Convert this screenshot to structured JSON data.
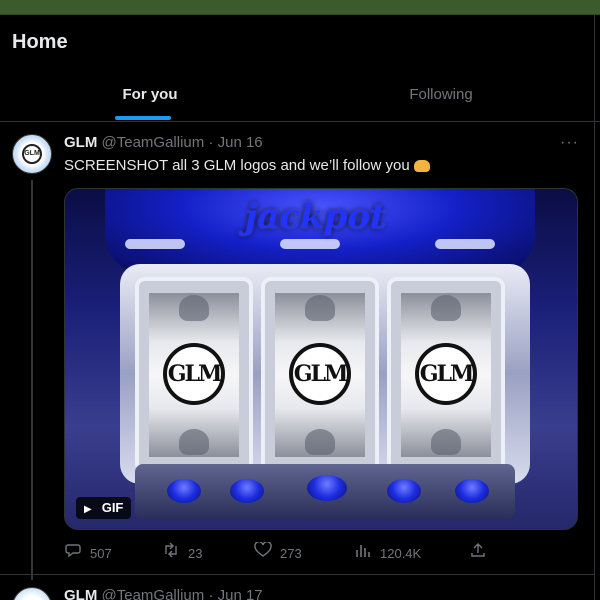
{
  "header": {
    "title": "Home",
    "tabs": [
      {
        "label": "For you",
        "active": true
      },
      {
        "label": "Following",
        "active": false
      }
    ]
  },
  "colors": {
    "accent": "#1d9bf0",
    "background": "#000000",
    "secondary_text": "#71767b",
    "top_strip": "#3b5b2c"
  },
  "post": {
    "author_name": "GLM",
    "handle": "@TeamGallium",
    "separator": "·",
    "date": "Jun 16",
    "more_icon": "more-icon",
    "text": "SCREENSHOT all 3 GLM logos and we’ll follow you",
    "emoji_icon": "handshake-icon",
    "media": {
      "sign_text": "jackpot",
      "reel_logos": [
        "GLM",
        "GLM",
        "GLM"
      ],
      "badge_label": "GIF",
      "badge_icon": "play-icon"
    },
    "actions": {
      "replies": "507",
      "reposts": "23",
      "likes": "273",
      "views": "120.4K"
    }
  },
  "next_post": {
    "author_name": "GLM",
    "handle": "@TeamGallium",
    "separator": "·",
    "date": "Jun 17"
  }
}
